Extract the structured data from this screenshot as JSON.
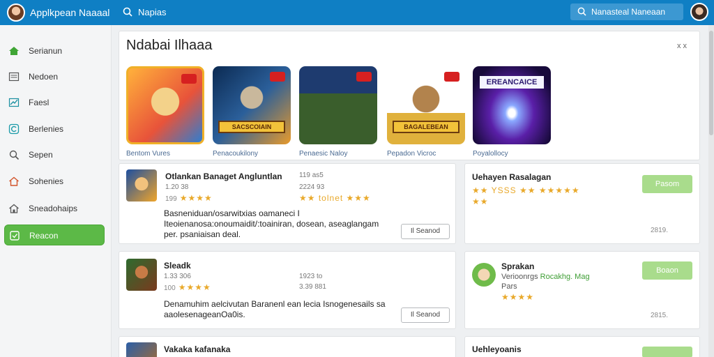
{
  "app": {
    "title": "Applkpean Naaaal"
  },
  "topbar": {
    "search_label": "Napias",
    "search_placeholder": "Nanasteal Naneaan"
  },
  "sidebar": {
    "items": [
      {
        "label": "Serianun",
        "icon": "home-icon",
        "active": false
      },
      {
        "label": "Nedoen",
        "icon": "list-icon",
        "active": false
      },
      {
        "label": "Faesl",
        "icon": "chart-icon",
        "active": false
      },
      {
        "label": "Berlenies",
        "icon": "refresh-icon",
        "active": false
      },
      {
        "label": "Sepen",
        "icon": "search-icon",
        "active": false
      },
      {
        "label": "Sohenies",
        "icon": "home-outline-icon",
        "active": false
      },
      {
        "label": "Sneadohaips",
        "icon": "house-icon",
        "active": false
      },
      {
        "label": "Reacon",
        "icon": "note-icon",
        "active": true
      }
    ]
  },
  "featured": {
    "title": "Ndabai Ilhaaa",
    "close": "x x",
    "games": [
      {
        "label": "Bentom Vures"
      },
      {
        "label": "Penacoukilony",
        "banner": "SACSCOIAIN"
      },
      {
        "label": "Penaesic Naloy"
      },
      {
        "label": "Pepadon Vicroc",
        "banner": "BAGALEBEAN"
      },
      {
        "label": "Poyalollocy",
        "banner": "EREANCAICE"
      }
    ]
  },
  "reviews": [
    {
      "title": "Otlankan Banaget Angluntlan",
      "meta1": "1.20 38",
      "meta2": "199",
      "stars": "★★★★",
      "side_meta1": "119 as5",
      "side_meta2": "2224 93",
      "side_stars": "★★ tolnet ★★★",
      "desc": "Basneniduan/osarwitxias oamaneci I Iteoienanosa:onoumaidit/:toainiran, dosean, aseaglangam per. psaniaisan deal.",
      "button": "Il Seanod"
    },
    {
      "title": "Sleadk",
      "meta1": "1.33 306",
      "meta2": "100",
      "stars": "★★★★",
      "side_meta1": "1923 to",
      "side_meta2": "3.39 881",
      "desc": "Denamuhim aelcivutan Baranenl ean lecia Isnogenesails sa aaolesenageanOa0is.",
      "button": "Il Seanod"
    },
    {
      "title": "Vakaka kafanaka"
    }
  ],
  "side_cards": [
    {
      "title": "Uehayen Rasalagan",
      "stars": "★★ YSSS ★★ ★★★★★ ★★",
      "button": "Pasom",
      "footer": "2819."
    },
    {
      "title": "Sprakan",
      "subtitle_a": "Verioonrgs",
      "subtitle_b": "Rocakhg. Mag",
      "subtitle_c": "Pars",
      "stars": "★★★★",
      "button": "Boaon",
      "footer": "2815."
    },
    {
      "title": "Uehleyoanis"
    }
  ],
  "colors": {
    "topbar": "#0f7fc4",
    "active_nav": "#5cb947",
    "accent_green": "#a9dc8c",
    "star": "#e9a92b"
  }
}
